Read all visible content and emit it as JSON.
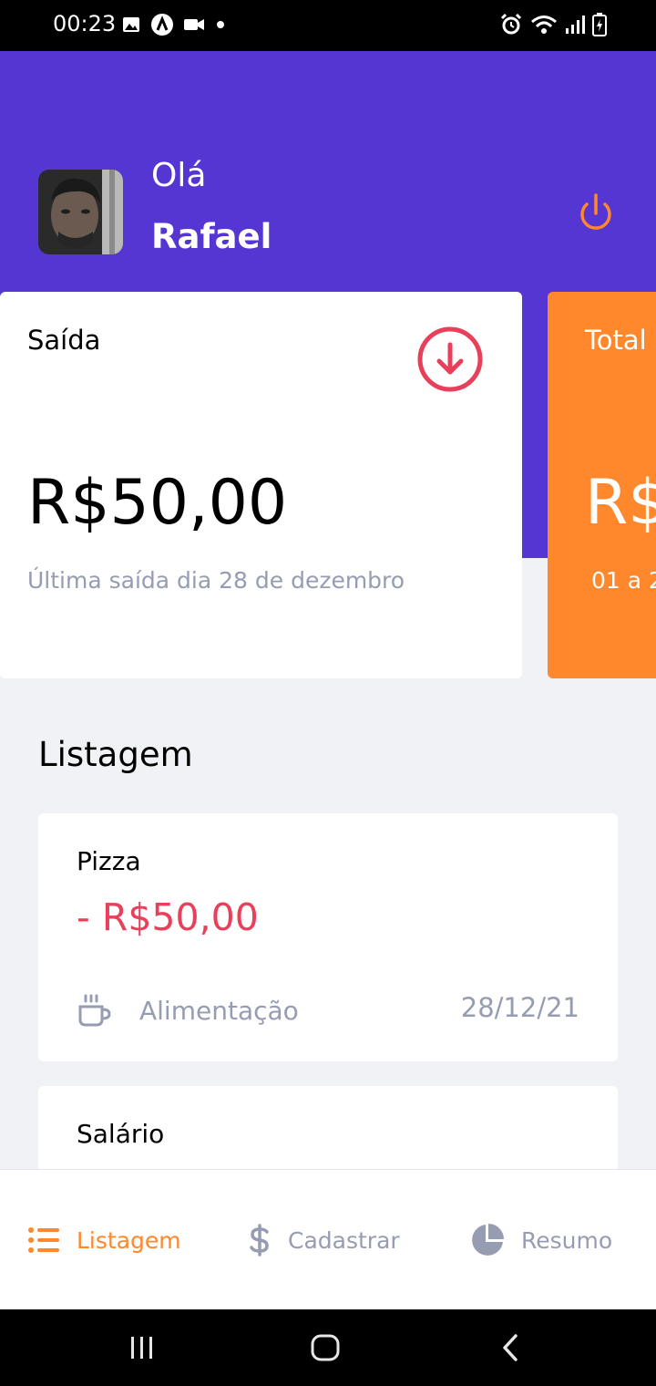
{
  "status_bar": {
    "time": "00:23",
    "icons": [
      "image-icon",
      "app-icon",
      "video-icon",
      "dot-icon",
      "alarm-icon",
      "wifi-icon",
      "signal-icon",
      "battery-icon"
    ]
  },
  "header": {
    "greeting": "Olá",
    "user_name": "Rafael",
    "logout_icon": "power-icon",
    "brand_color": "#5636D3"
  },
  "cards": [
    {
      "title": "Saída",
      "icon": "arrow-down-circle-icon",
      "amount": "R$50,00",
      "last_transaction": "Última saída dia 28 de dezembro",
      "accent": "#E83F5B"
    },
    {
      "title": "Total",
      "amount": "R$",
      "last_transaction": "01 a 2",
      "background": "#FF872C"
    }
  ],
  "listing": {
    "title": "Listagem",
    "transactions": [
      {
        "name": "Pizza",
        "amount": "- R$50,00",
        "category_icon": "coffee-icon",
        "category": "Alimentação",
        "date": "28/12/21"
      },
      {
        "name": "Salário"
      }
    ]
  },
  "tabbar": {
    "tabs": [
      {
        "label": "Listagem",
        "icon": "list-icon",
        "active": true
      },
      {
        "label": "Cadastrar",
        "icon": "dollar-icon",
        "active": false
      },
      {
        "label": "Resumo",
        "icon": "pie-chart-icon",
        "active": false
      }
    ],
    "active_color": "#FF872C",
    "inactive_color": "#969CB2"
  },
  "nav_bar": {
    "buttons": [
      "recent-apps-icon",
      "home-icon",
      "back-icon"
    ]
  }
}
